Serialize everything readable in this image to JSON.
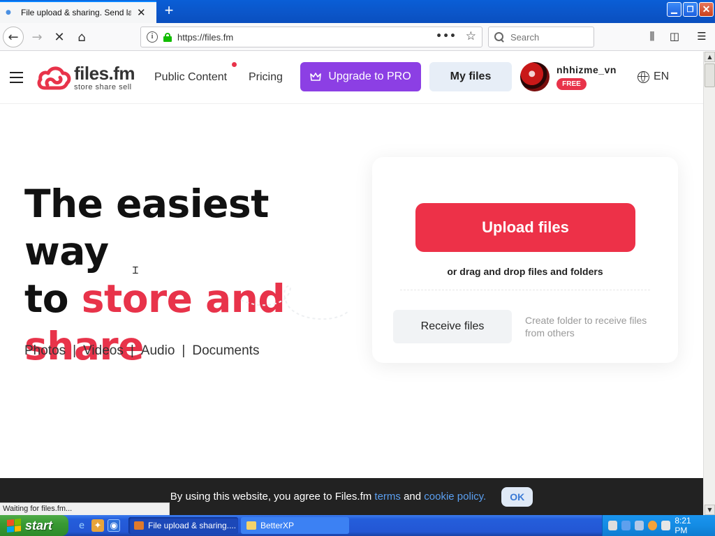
{
  "browser": {
    "tab_title": "File upload & sharing. Send large p",
    "new_tab_symbol": "+",
    "url": "https://files.fm",
    "search_placeholder": "Search",
    "status_text": "Waiting for files.fm...",
    "window_controls": [
      "minimize-icon",
      "restore-icon",
      "close-icon"
    ],
    "toolbar_icons": [
      "library-icon",
      "sidebar-icon",
      "menu-icon"
    ]
  },
  "site": {
    "brand_name": "files.fm",
    "brand_tagline": "store  share  sell",
    "nav": {
      "public_content": "Public Content",
      "pricing": "Pricing",
      "upgrade": "Upgrade to PRO",
      "my_files": "My files"
    },
    "user": {
      "name": "nhhizme_vn",
      "plan_badge": "FREE"
    },
    "language": "EN",
    "colors": {
      "accent_red": "#e8334a",
      "upgrade_purple": "#8c3fe4",
      "my_files_bg": "#e7eef7"
    }
  },
  "hero": {
    "line1": "The easiest way",
    "line2_prefix": "to ",
    "line2_highlight": "store and",
    "line3": "share",
    "categories": [
      "Photos",
      "Videos",
      "Audio",
      "Documents"
    ],
    "separator": "|"
  },
  "upload_card": {
    "upload_button": "Upload files",
    "drag_drop_text": "or drag and drop files and folders",
    "receive_button": "Receive files",
    "receive_description": "Create folder to receive files from others"
  },
  "cookie_bar": {
    "text_before": "By using this website, you agree to Files.fm ",
    "terms_link": "terms",
    "text_middle": " and ",
    "cookie_link": "cookie policy.",
    "ok_button": "OK"
  },
  "taskbar": {
    "start_label": "start",
    "tasks": [
      {
        "label": "File upload & sharing....",
        "active": true
      },
      {
        "label": "BetterXP",
        "active": false
      }
    ],
    "clock": "8:21 PM"
  }
}
